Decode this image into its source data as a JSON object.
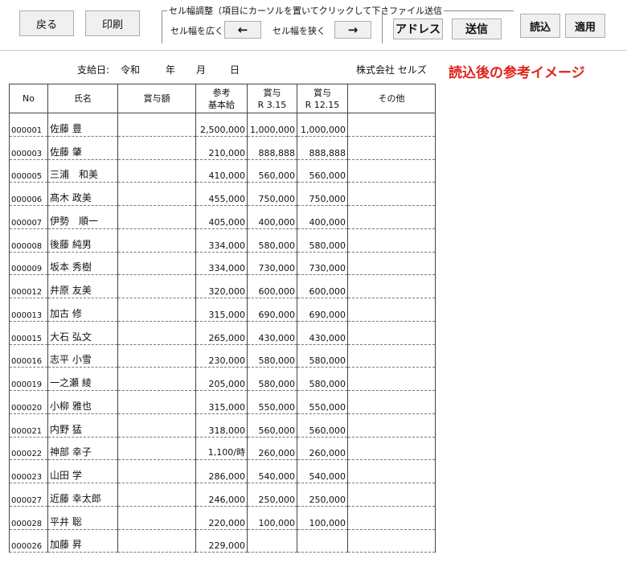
{
  "toolbar": {
    "back_label": "戻る",
    "print_label": "印刷",
    "cell_group_title": "セル幅調整（項目にカーソルを置いてクリックして下さい）",
    "widen_label": "セル幅を広く",
    "widen_arrow": "←",
    "narrow_label": "セル幅を狭く",
    "narrow_arrow": "→",
    "file_group_title": "ファイル送信",
    "address_label": "アドレス",
    "send_label": "送信",
    "load_label": "読込",
    "apply_label": "適用"
  },
  "info": {
    "pay_date_label": "支給日:",
    "era": "令和",
    "year_unit": "年",
    "month_unit": "月",
    "day_unit": "日",
    "company": "株式会社 セルズ",
    "note": "読込後の参考イメージ"
  },
  "table": {
    "headers": {
      "no": "No",
      "name": "氏名",
      "bonus_amount": "賞与額",
      "ref_base_line1": "参考",
      "ref_base_line2": "基本給",
      "bonus1_line1": "賞与",
      "bonus1_line2": "R  3.15",
      "bonus2_line1": "賞与",
      "bonus2_line2": "R  12.15",
      "other": "その他"
    },
    "rows": [
      {
        "no": "000001",
        "name": "佐藤 豊",
        "amount": "",
        "base": "2,500,000",
        "b1": "1,000,000",
        "b2": "1,000,000",
        "other": ""
      },
      {
        "no": "000003",
        "name": "佐藤 肇",
        "amount": "",
        "base": "210,000",
        "b1": "888,888",
        "b2": "888,888",
        "other": ""
      },
      {
        "no": "000005",
        "name": "三浦　和美",
        "amount": "",
        "base": "410,000",
        "b1": "560,000",
        "b2": "560,000",
        "other": ""
      },
      {
        "no": "000006",
        "name": "髙木 政美",
        "amount": "",
        "base": "455,000",
        "b1": "750,000",
        "b2": "750,000",
        "other": ""
      },
      {
        "no": "000007",
        "name": "伊勢　順一",
        "amount": "",
        "base": "405,000",
        "b1": "400,000",
        "b2": "400,000",
        "other": ""
      },
      {
        "no": "000008",
        "name": "後藤 純男",
        "amount": "",
        "base": "334,000",
        "b1": "580,000",
        "b2": "580,000",
        "other": ""
      },
      {
        "no": "000009",
        "name": "坂本 秀樹",
        "amount": "",
        "base": "334,000",
        "b1": "730,000",
        "b2": "730,000",
        "other": ""
      },
      {
        "no": "000012",
        "name": "井原 友美",
        "amount": "",
        "base": "320,000",
        "b1": "600,000",
        "b2": "600,000",
        "other": ""
      },
      {
        "no": "000013",
        "name": "加古 修",
        "amount": "",
        "base": "315,000",
        "b1": "690,000",
        "b2": "690,000",
        "other": ""
      },
      {
        "no": "000015",
        "name": "大石 弘文",
        "amount": "",
        "base": "265,000",
        "b1": "430,000",
        "b2": "430,000",
        "other": ""
      },
      {
        "no": "000016",
        "name": "志平 小雪",
        "amount": "",
        "base": "230,000",
        "b1": "580,000",
        "b2": "580,000",
        "other": ""
      },
      {
        "no": "000019",
        "name": "一之瀬 綾",
        "amount": "",
        "base": "205,000",
        "b1": "580,000",
        "b2": "580,000",
        "other": ""
      },
      {
        "no": "000020",
        "name": "小柳 雅也",
        "amount": "",
        "base": "315,000",
        "b1": "550,000",
        "b2": "550,000",
        "other": ""
      },
      {
        "no": "000021",
        "name": "内野 猛",
        "amount": "",
        "base": "318,000",
        "b1": "560,000",
        "b2": "560,000",
        "other": ""
      },
      {
        "no": "000022",
        "name": "神部 幸子",
        "amount": "",
        "base": "1,100/時",
        "b1": "260,000",
        "b2": "260,000",
        "other": ""
      },
      {
        "no": "000023",
        "name": "山田 学",
        "amount": "",
        "base": "286,000",
        "b1": "540,000",
        "b2": "540,000",
        "other": ""
      },
      {
        "no": "000027",
        "name": "近藤 幸太郎",
        "amount": "",
        "base": "246,000",
        "b1": "250,000",
        "b2": "250,000",
        "other": ""
      },
      {
        "no": "000028",
        "name": "平井 聡",
        "amount": "",
        "base": "220,000",
        "b1": "100,000",
        "b2": "100,000",
        "other": ""
      },
      {
        "no": "000026",
        "name": "加藤 昇",
        "amount": "",
        "base": "229,000",
        "b1": "",
        "b2": "",
        "other": ""
      }
    ]
  }
}
